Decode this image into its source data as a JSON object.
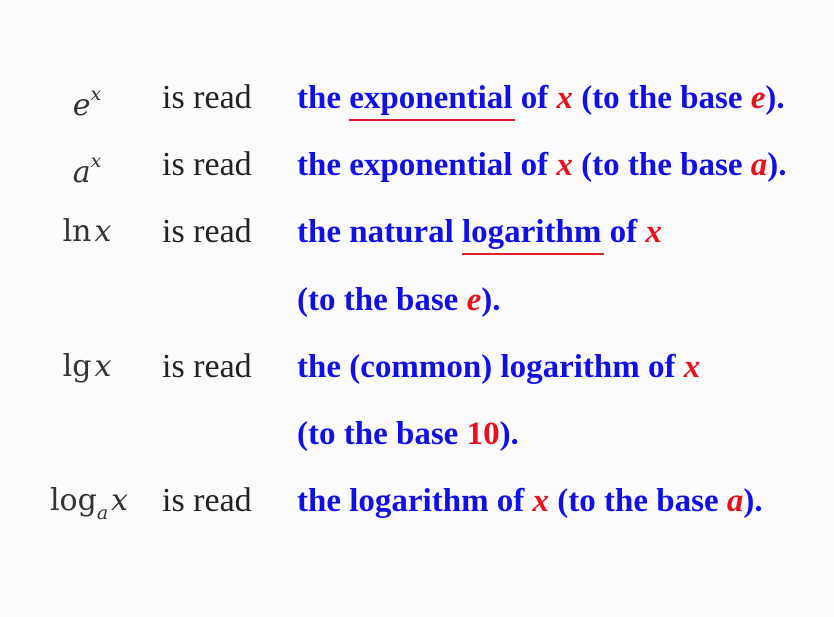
{
  "rows": [
    {
      "math": {
        "base": "e",
        "sup": "x"
      },
      "verb": "is read",
      "phrase": {
        "pre": "the ",
        "underlined": "exponential",
        "mid": " of ",
        "var": "x",
        "post1": " (to the base ",
        "base": "e",
        "post2": ")."
      }
    },
    {
      "math": {
        "base": "a",
        "sup": "x"
      },
      "verb": "is read",
      "phrase": {
        "pre": "the exponential of ",
        "var": "x",
        "post1": " (to the base ",
        "base": "a",
        "post2": ")."
      }
    },
    {
      "math": {
        "func": "ln",
        "var": "x"
      },
      "verb": "is read",
      "phrase": {
        "pre": "the natural ",
        "underlined": "logarithm",
        "mid": " of ",
        "var": "x"
      },
      "continuation": {
        "pre": "(to the base ",
        "base": "e",
        "post": ")."
      }
    },
    {
      "math": {
        "func": "lg",
        "var": "x"
      },
      "verb": "is read",
      "phrase": {
        "pre": "the (common) logarithm of ",
        "var": "x"
      },
      "continuation": {
        "pre": "(to the base ",
        "base": "10",
        "post": ")."
      }
    },
    {
      "math": {
        "func": "log",
        "sub": "a",
        "var": "x"
      },
      "verb": "is read",
      "phrase": {
        "pre": "the logarithm of ",
        "var": "x",
        "post1": " (to the base ",
        "base": "a",
        "post2": ")."
      }
    }
  ],
  "colors": {
    "phrase_text": "#1010e6",
    "variable": "#e8101c",
    "underline": "#e0202a",
    "math_text": "#333333",
    "background": "#fbfbfe"
  }
}
